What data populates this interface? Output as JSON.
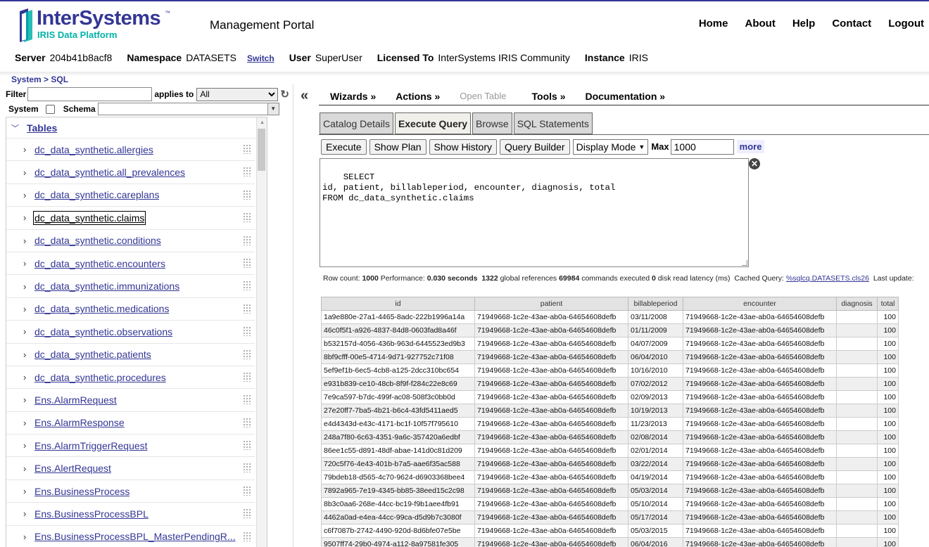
{
  "header": {
    "logo_text": "InterSystems",
    "logo_tm": "™",
    "logo_sub": "IRIS Data Platform",
    "portal_title": "Management Portal",
    "nav": [
      "Home",
      "About",
      "Help",
      "Contact",
      "Logout"
    ],
    "brand_color": "#333695",
    "accent_color": "#00b2a9"
  },
  "info": {
    "server_label": "Server",
    "server": "204b41b8acf8",
    "namespace_label": "Namespace",
    "namespace": "DATASETS",
    "switch": "Switch",
    "user_label": "User",
    "user": "SuperUser",
    "licensed_label": "Licensed To",
    "licensed": "InterSystems IRIS Community",
    "instance_label": "Instance",
    "instance": "IRIS"
  },
  "breadcrumb": {
    "system": "System",
    "sep": " > ",
    "sql": "SQL"
  },
  "filter": {
    "label": "Filter",
    "value": "",
    "applies_label": "applies to",
    "applies_value": "All",
    "system_label": "System",
    "schema_label": "Schema",
    "schema_value": ""
  },
  "tree": {
    "title": "Tables",
    "items": [
      "dc_data_synthetic.allergies",
      "dc_data_synthetic.all_prevalences",
      "dc_data_synthetic.careplans",
      "dc_data_synthetic.claims",
      "dc_data_synthetic.conditions",
      "dc_data_synthetic.encounters",
      "dc_data_synthetic.immunizations",
      "dc_data_synthetic.medications",
      "dc_data_synthetic.observations",
      "dc_data_synthetic.patients",
      "dc_data_synthetic.procedures",
      "Ens.AlarmRequest",
      "Ens.AlarmResponse",
      "Ens.AlarmTriggerRequest",
      "Ens.AlertRequest",
      "Ens.BusinessProcess",
      "Ens.BusinessProcessBPL",
      "Ens.BusinessProcessBPL_MasterPendingR..."
    ],
    "selected_index": 3
  },
  "menu": {
    "wizards": "Wizards »",
    "actions": "Actions »",
    "open_table": "Open Table",
    "tools": "Tools »",
    "documentation": "Documentation »"
  },
  "tabs": [
    "Catalog Details",
    "Execute Query",
    "Browse",
    "SQL Statements"
  ],
  "active_tab": 1,
  "query_toolbar": {
    "execute": "Execute",
    "show_plan": "Show Plan",
    "show_history": "Show History",
    "query_builder": "Query Builder",
    "display_mode": "Display Mode",
    "max_label": "Max",
    "max_value": "1000",
    "more": "more"
  },
  "sql_text": "SELECT\nid, patient, billableperiod, encounter, diagnosis, total\nFROM dc_data_synthetic.claims",
  "perf": {
    "row_count_label": "Row count:",
    "row_count": "1000",
    "performance_label": "Performance:",
    "performance": "0.030 seconds",
    "global_refs": "1322",
    "global_refs_label": "global references",
    "commands": "69984",
    "commands_label": "commands executed",
    "disk_latency": "0",
    "disk_latency_label": "disk read latency (ms)",
    "cached_label": "Cached Query:",
    "cached_query": "%sqlcq.DATASETS.cls26",
    "last_update_label": "Last update:"
  },
  "results": {
    "columns": [
      "id",
      "patient",
      "billableperiod",
      "encounter",
      "diagnosis",
      "total"
    ],
    "rows": [
      [
        "1a9e880e-27a1-4465-8adc-222b1996a14a",
        "71949668-1c2e-43ae-ab0a-64654608defb",
        "03/11/2008",
        "71949668-1c2e-43ae-ab0a-64654608defb",
        "",
        "100"
      ],
      [
        "46c0f5f1-a926-4837-84d8-0603fad8a46f",
        "71949668-1c2e-43ae-ab0a-64654608defb",
        "01/11/2009",
        "71949668-1c2e-43ae-ab0a-64654608defb",
        "",
        "100"
      ],
      [
        "b532157d-4056-436b-963d-6445523ed9b3",
        "71949668-1c2e-43ae-ab0a-64654608defb",
        "04/07/2009",
        "71949668-1c2e-43ae-ab0a-64654608defb",
        "",
        "100"
      ],
      [
        "8bf9cfff-00e5-4714-9d71-927752c71f08",
        "71949668-1c2e-43ae-ab0a-64654608defb",
        "06/04/2010",
        "71949668-1c2e-43ae-ab0a-64654608defb",
        "",
        "100"
      ],
      [
        "5ef9ef1b-6ec5-4cb8-a125-2dcc310bc654",
        "71949668-1c2e-43ae-ab0a-64654608defb",
        "10/16/2010",
        "71949668-1c2e-43ae-ab0a-64654608defb",
        "",
        "100"
      ],
      [
        "e931b839-ce10-48cb-8f9f-f284c22e8c69",
        "71949668-1c2e-43ae-ab0a-64654608defb",
        "07/02/2012",
        "71949668-1c2e-43ae-ab0a-64654608defb",
        "",
        "100"
      ],
      [
        "7e9ca597-b7dc-499f-ac08-508f3c0bb0d",
        "71949668-1c2e-43ae-ab0a-64654608defb",
        "02/09/2013",
        "71949668-1c2e-43ae-ab0a-64654608defb",
        "",
        "100"
      ],
      [
        "27e20ff7-7ba5-4b21-b6c4-43fd5411aed5",
        "71949668-1c2e-43ae-ab0a-64654608defb",
        "10/19/2013",
        "71949668-1c2e-43ae-ab0a-64654608defb",
        "",
        "100"
      ],
      [
        "e4d4343d-e43c-4171-bc1f-10f57f795610",
        "71949668-1c2e-43ae-ab0a-64654608defb",
        "11/23/2013",
        "71949668-1c2e-43ae-ab0a-64654608defb",
        "",
        "100"
      ],
      [
        "248a7f80-6c63-4351-9a6c-357420a6edbf",
        "71949668-1c2e-43ae-ab0a-64654608defb",
        "02/08/2014",
        "71949668-1c2e-43ae-ab0a-64654608defb",
        "",
        "100"
      ],
      [
        "86ee1c55-d891-48df-abae-141d0c81d209",
        "71949668-1c2e-43ae-ab0a-64654608defb",
        "02/01/2014",
        "71949668-1c2e-43ae-ab0a-64654608defb",
        "",
        "100"
      ],
      [
        "720c5f76-4e43-401b-b7a5-aae6f35ac588",
        "71949668-1c2e-43ae-ab0a-64654608defb",
        "03/22/2014",
        "71949668-1c2e-43ae-ab0a-64654608defb",
        "",
        "100"
      ],
      [
        "79bdeb18-d565-4c70-9624-d6903368bee4",
        "71949668-1c2e-43ae-ab0a-64654608defb",
        "04/19/2014",
        "71949668-1c2e-43ae-ab0a-64654608defb",
        "",
        "100"
      ],
      [
        "7892a965-7e19-4345-bb85-38eed15c2c98",
        "71949668-1c2e-43ae-ab0a-64654608defb",
        "05/03/2014",
        "71949668-1c2e-43ae-ab0a-64654608defb",
        "",
        "100"
      ],
      [
        "8b3c0aa6-268e-44cc-bc19-f9b1aee4fb91",
        "71949668-1c2e-43ae-ab0a-64654608defb",
        "05/10/2014",
        "71949668-1c2e-43ae-ab0a-64654608defb",
        "",
        "100"
      ],
      [
        "4462a0ad-e4ea-44cc-99ca-d5d9b7c3080f",
        "71949668-1c2e-43ae-ab0a-64654608defb",
        "05/17/2014",
        "71949668-1c2e-43ae-ab0a-64654608defb",
        "",
        "100"
      ],
      [
        "c6f7087b-2742-4490-920d-8d6bfe07e5be",
        "71949668-1c2e-43ae-ab0a-64654608defb",
        "05/03/2015",
        "71949668-1c2e-43ae-ab0a-64654608defb",
        "",
        "100"
      ],
      [
        "9507ff74-29b0-4974-a112-8a97581fe305",
        "71949668-1c2e-43ae-ab0a-64654608defb",
        "06/04/2016",
        "71949668-1c2e-43ae-ab0a-64654608defb",
        "",
        "100"
      ]
    ]
  }
}
